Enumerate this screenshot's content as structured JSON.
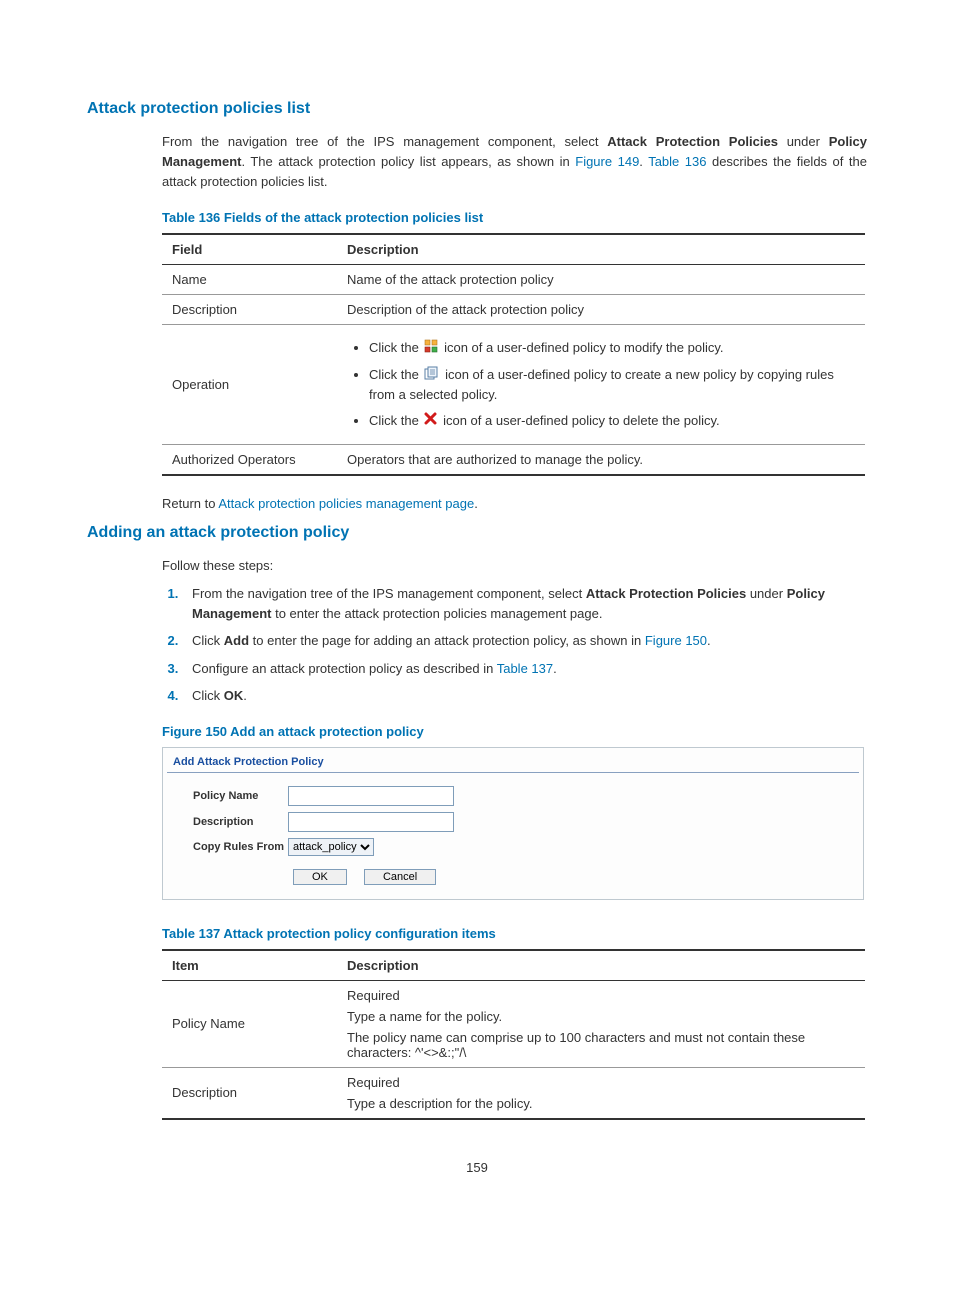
{
  "section1": {
    "heading": "Attack protection policies list",
    "intro_pre": "From the navigation tree of the IPS management component, select ",
    "intro_b1": "Attack Protection Policies",
    "intro_mid1": " under ",
    "intro_b2": "Policy Management",
    "intro_mid2": ". The attack protection policy list appears, as shown in ",
    "intro_link1": "Figure 149",
    "intro_dot": ". ",
    "intro_link2": "Table 136",
    "intro_tail": " describes the fields of the attack protection policies list.",
    "return_pre": "Return to ",
    "return_link": "Attack protection policies management page",
    "return_dot": "."
  },
  "table136": {
    "caption": "Table 136 Fields of the attack protection policies list",
    "h1": "Field",
    "h2": "Description",
    "rows": [
      {
        "f": "Name",
        "d": "Name of the attack protection policy"
      },
      {
        "f": "Description",
        "d": "Description of the attack protection policy"
      }
    ],
    "op_f": "Operation",
    "op_b1_pre": "Click the ",
    "op_b1_post": " icon of a user-defined policy to modify the policy.",
    "op_b2_pre": "Click the ",
    "op_b2_post": " icon of a user-defined policy to create a new policy by copying rules from a selected policy.",
    "op_b3_pre": "Click the ",
    "op_b3_post": " icon of a user-defined policy to delete the policy.",
    "r4_f": "Authorized Operators",
    "r4_d": "Operators that are authorized to manage the policy."
  },
  "section2": {
    "heading": "Adding an attack protection policy",
    "intro": "Follow these steps:",
    "step1_pre": "From the navigation tree of the IPS management component, select ",
    "step1_b1": "Attack Protection Policies",
    "step1_mid": " under ",
    "step1_b2": "Policy Management",
    "step1_post": " to enter the attack protection policies management page.",
    "step2_pre": "Click ",
    "step2_b": "Add",
    "step2_mid": " to enter the page for adding an attack protection policy, as shown in ",
    "step2_link": "Figure 150",
    "step2_dot": ".",
    "step3_pre": "Configure an attack protection policy as described in ",
    "step3_link": "Table 137",
    "step3_dot": ".",
    "step4_pre": "Click ",
    "step4_b": "OK",
    "step4_dot": "."
  },
  "figure150": {
    "caption": "Figure 150 Add an attack protection policy",
    "head": "Add Attack Protection Policy",
    "lbl_name": "Policy Name",
    "lbl_desc": "Description",
    "lbl_copy": "Copy Rules From",
    "select_val": "attack_policy",
    "btn_ok": "OK",
    "btn_cancel": "Cancel"
  },
  "table137": {
    "caption": "Table 137 Attack protection policy configuration items",
    "h1": "Item",
    "h2": "Description",
    "r1_f": "Policy Name",
    "r1_l1": "Required",
    "r1_l2": "Type a name for the policy.",
    "r1_l3": "The policy name can comprise up to 100 characters and must not contain these characters: ^'<>&:;\"/\\",
    "r2_f": "Description",
    "r2_l1": "Required",
    "r2_l2": "Type a description for the policy."
  },
  "pagenum": "159",
  "chart_data": {
    "type": "table",
    "tables": [
      {
        "title": "Table 136 Fields of the attack protection policies list",
        "columns": [
          "Field",
          "Description"
        ],
        "rows": [
          [
            "Name",
            "Name of the attack protection policy"
          ],
          [
            "Description",
            "Description of the attack protection policy"
          ],
          [
            "Operation",
            "Click the modify icon of a user-defined policy to modify the policy. Click the copy icon of a user-defined policy to create a new policy by copying rules from a selected policy. Click the delete icon of a user-defined policy to delete the policy."
          ],
          [
            "Authorized Operators",
            "Operators that are authorized to manage the policy."
          ]
        ]
      },
      {
        "title": "Table 137 Attack protection policy configuration items",
        "columns": [
          "Item",
          "Description"
        ],
        "rows": [
          [
            "Policy Name",
            "Required. Type a name for the policy. The policy name can comprise up to 100 characters and must not contain these characters: ^'<>&:;\"/\\"
          ],
          [
            "Description",
            "Required. Type a description for the policy."
          ]
        ]
      }
    ]
  }
}
